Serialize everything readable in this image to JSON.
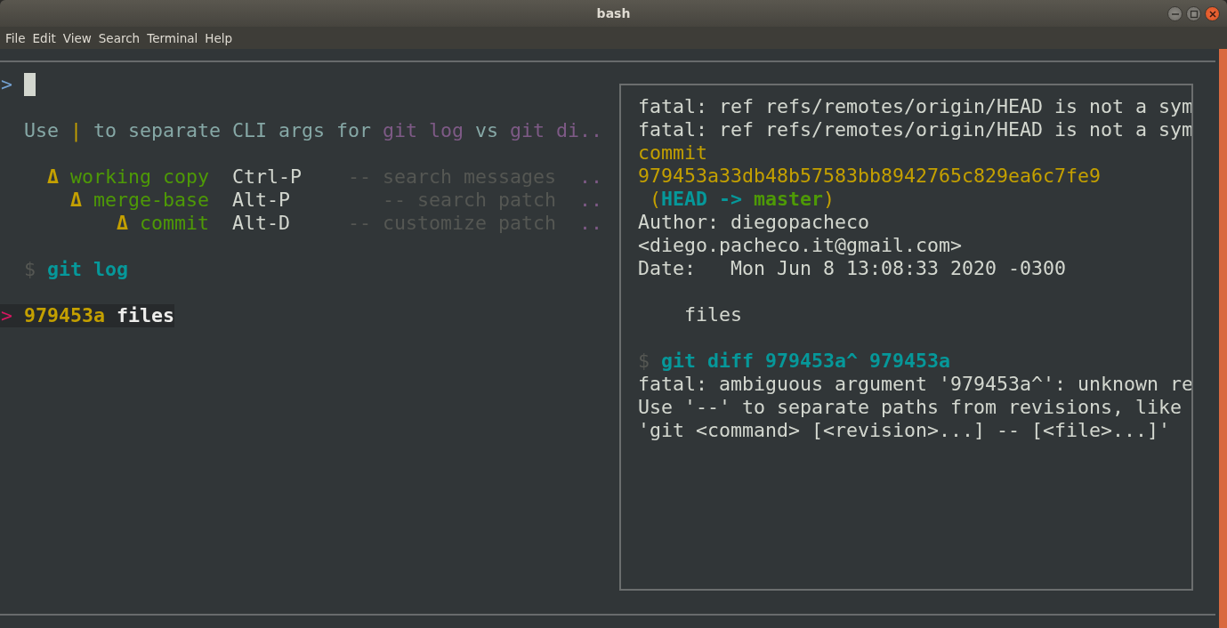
{
  "window": {
    "title": "bash",
    "menu": [
      "File",
      "Edit",
      "View",
      "Search",
      "Terminal",
      "Help"
    ]
  },
  "prompt": {
    "symbol": ">"
  },
  "help": [
    {
      "kind": "text",
      "text": "Use "
    },
    {
      "kind": "pipe",
      "text": "|"
    },
    {
      "kind": "text",
      "text": " to separate CLI args for "
    },
    {
      "kind": "command",
      "text": "git log"
    },
    {
      "kind": "text",
      "text": " vs "
    },
    {
      "kind": "command",
      "text": "git di.."
    }
  ],
  "bindings": [
    {
      "delta": "Δ",
      "label": "working copy",
      "key": "Ctrl-P",
      "description": "-- search messages",
      "more": ".."
    },
    {
      "delta": "Δ",
      "label": "merge-base",
      "key": "Alt-P",
      "description": "-- search patch",
      "more": ".."
    },
    {
      "delta": "Δ",
      "label": "commit",
      "key": "Alt-D",
      "description": "-- customize patch",
      "more": ".."
    }
  ],
  "command": {
    "symbol": "$",
    "text": "git log"
  },
  "commits": [
    {
      "marker": ">",
      "hash": "979453a",
      "message": "files",
      "selected": true
    }
  ],
  "preview": [
    {
      "lines": [
        [
          {
            "kind": "text",
            "text": "fatal: ref refs/remotes/origin/HEAD is not a sym"
          }
        ],
        [
          {
            "kind": "text",
            "text": "fatal: ref refs/remotes/origin/HEAD is not a sym"
          }
        ],
        [
          {
            "kind": "hash",
            "text": "commit"
          }
        ],
        [
          {
            "kind": "hash",
            "text": "979453a33db48b57583bb8942765c829ea6c7fe9"
          }
        ],
        [
          {
            "kind": "paren",
            "text": " ("
          },
          {
            "kind": "head",
            "text": "HEAD -> "
          },
          {
            "kind": "branch",
            "text": "master"
          },
          {
            "kind": "paren",
            "text": ")"
          }
        ],
        [
          {
            "kind": "text",
            "text": "Author: diegopacheco"
          }
        ],
        [
          {
            "kind": "text",
            "text": "<diego.pacheco.it@gmail.com>"
          }
        ],
        [
          {
            "kind": "text",
            "text": "Date:   Mon Jun 8 13:08:33 2020 -0300"
          }
        ]
      ]
    },
    {
      "lines": [
        [
          {
            "kind": "text",
            "text": "    files"
          }
        ]
      ]
    },
    {
      "lines": [
        [
          {
            "kind": "dollar",
            "text": "$"
          },
          {
            "kind": "head",
            "text": " git diff 979453a^ 979453a"
          }
        ],
        [
          {
            "kind": "text",
            "text": "fatal: ambiguous argument '979453a^': unknown re"
          }
        ],
        [
          {
            "kind": "text",
            "text": "Use '--' to separate paths from revisions, like"
          }
        ],
        [
          {
            "kind": "text",
            "text": "'git <command> [<revision>...] -- [<file>...]'"
          }
        ]
      ]
    }
  ]
}
